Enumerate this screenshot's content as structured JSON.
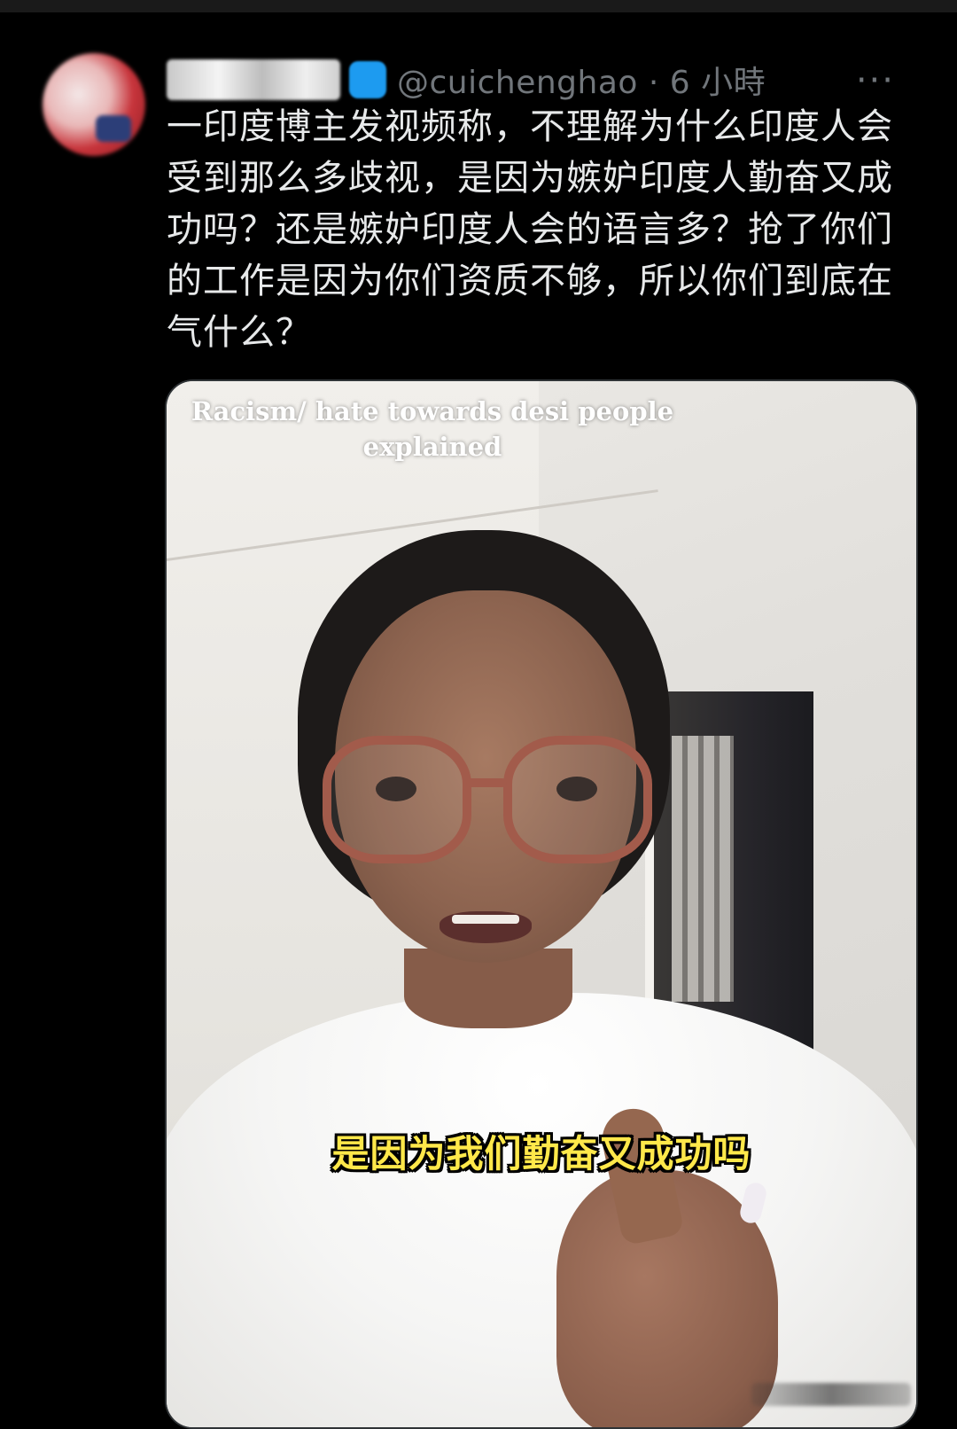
{
  "post": {
    "handle": "@cuichenghao",
    "time": "6 小時",
    "text_lines": [
      "一印度博主发视频称，不理解为什么印度人会",
      "受到那么多歧视，是因为嫉妒印度人勤奋又成",
      "功吗？还是嫉妒印度人会的语言多？抢了你们",
      "的工作是因为你们资质不够，所以你们到底在",
      "气什么？"
    ],
    "more_label": "···"
  },
  "video": {
    "title_lines": [
      "Racism/ hate towards desi people",
      "explained"
    ],
    "subtitle": "是因为我们勤奋又成功吗"
  }
}
